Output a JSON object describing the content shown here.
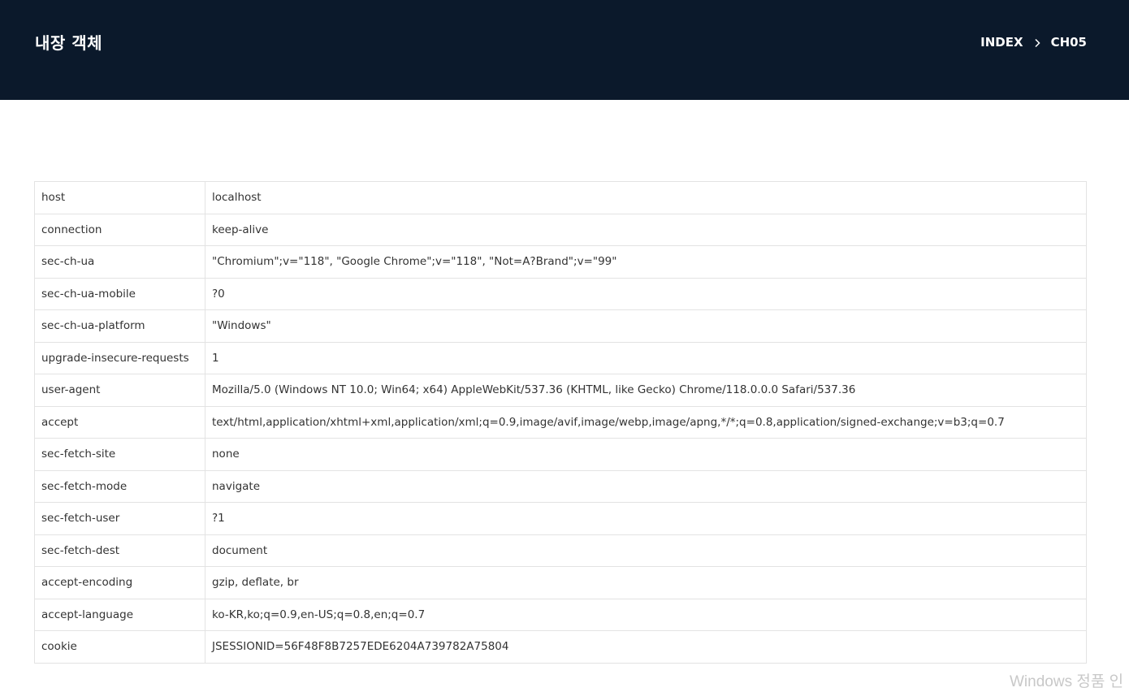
{
  "header": {
    "title": "내장 객체",
    "breadcrumb": [
      {
        "label": "INDEX"
      },
      {
        "label": "CH05"
      }
    ],
    "separator_icon": "chevron-right-icon",
    "background_color": "#0b192b"
  },
  "table": {
    "rows": [
      {
        "key": "host",
        "value": "localhost"
      },
      {
        "key": "connection",
        "value": "keep-alive"
      },
      {
        "key": "sec-ch-ua",
        "value": "\"Chromium\";v=\"118\", \"Google Chrome\";v=\"118\", \"Not=A?Brand\";v=\"99\""
      },
      {
        "key": "sec-ch-ua-mobile",
        "value": "?0"
      },
      {
        "key": "sec-ch-ua-platform",
        "value": "\"Windows\""
      },
      {
        "key": "upgrade-insecure-requests",
        "value": "1"
      },
      {
        "key": "user-agent",
        "value": "Mozilla/5.0 (Windows NT 10.0; Win64; x64) AppleWebKit/537.36 (KHTML, like Gecko) Chrome/118.0.0.0 Safari/537.36"
      },
      {
        "key": "accept",
        "value": "text/html,application/xhtml+xml,application/xml;q=0.9,image/avif,image/webp,image/apng,*/*;q=0.8,application/signed-exchange;v=b3;q=0.7"
      },
      {
        "key": "sec-fetch-site",
        "value": "none"
      },
      {
        "key": "sec-fetch-mode",
        "value": "navigate"
      },
      {
        "key": "sec-fetch-user",
        "value": "?1"
      },
      {
        "key": "sec-fetch-dest",
        "value": "document"
      },
      {
        "key": "accept-encoding",
        "value": "gzip, deflate, br"
      },
      {
        "key": "accept-language",
        "value": "ko-KR,ko;q=0.9,en-US;q=0.8,en;q=0.7"
      },
      {
        "key": "cookie",
        "value": "JSESSIONID=56F48F8B7257EDE6204A739782A75804"
      }
    ]
  },
  "watermark": {
    "text": "Windows 정품 인"
  }
}
